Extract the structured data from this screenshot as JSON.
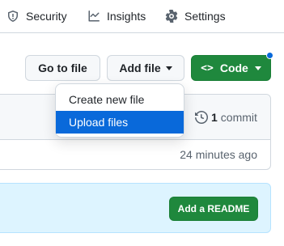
{
  "repo_nav": {
    "items": [
      {
        "label": "Security",
        "icon": "shield-icon"
      },
      {
        "label": "Insights",
        "icon": "graph-icon"
      },
      {
        "label": "Settings",
        "icon": "gear-icon"
      }
    ]
  },
  "toolbar": {
    "go_to_file_label": "Go to file",
    "add_file_label": "Add file",
    "code_label": "Code",
    "code_glyph": "<>"
  },
  "add_file_menu": {
    "items": [
      {
        "label": "Create new file",
        "selected": false
      },
      {
        "label": "Upload files",
        "selected": true
      }
    ]
  },
  "file_box": {
    "commit_count": "1",
    "commit_word": "commit",
    "last_updated": "24 minutes ago"
  },
  "readme_banner": {
    "button_label": "Add a README"
  },
  "colors": {
    "primary_green": "#1f883d",
    "accent_blue": "#0969da",
    "banner_bg": "#ddf4ff"
  }
}
